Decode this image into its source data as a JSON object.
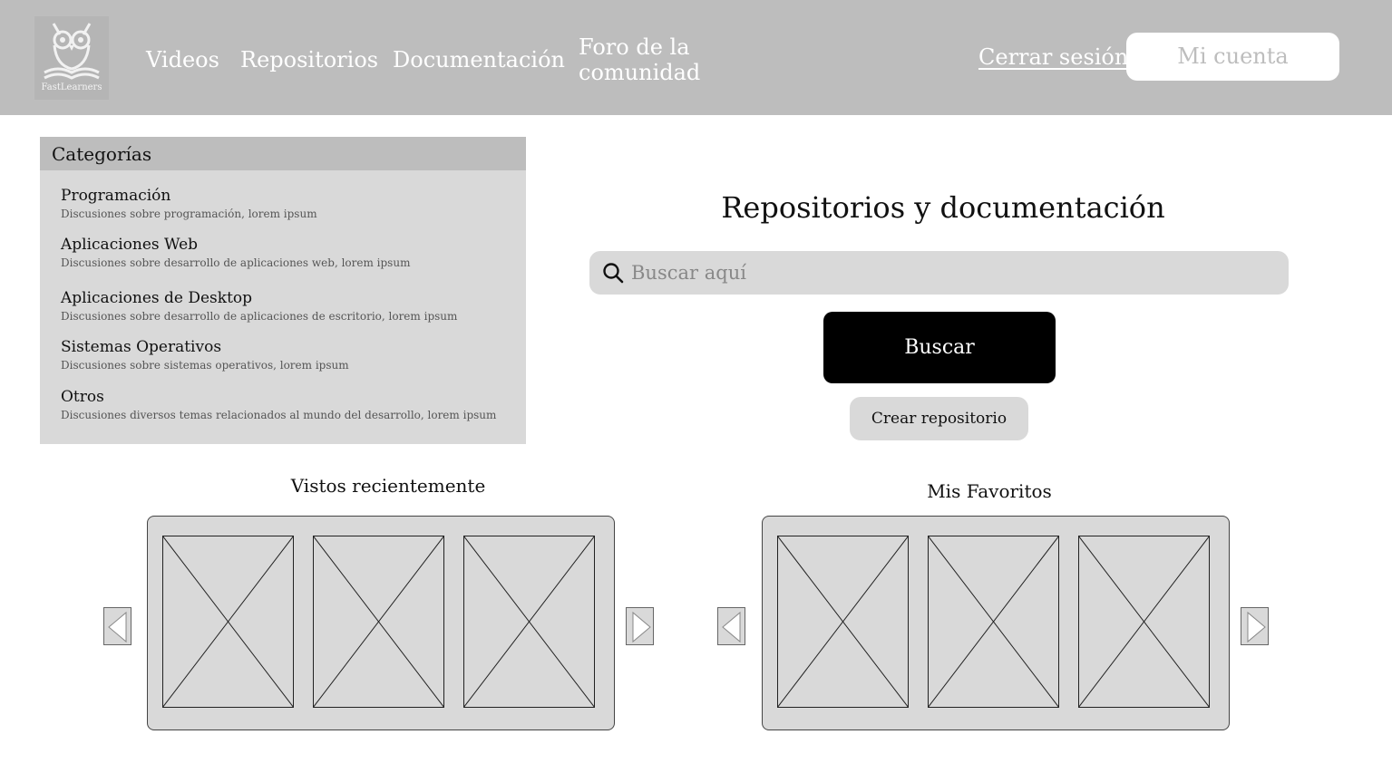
{
  "header": {
    "logo_text": "FastLearners",
    "nav": [
      {
        "label": "Videos"
      },
      {
        "label": "Repositorios"
      },
      {
        "label": "Documentación"
      },
      {
        "label": "Foro de la comunidad"
      }
    ],
    "logout_label": "Cerrar sesión",
    "account_label": "Mi cuenta"
  },
  "categories": {
    "title": "Categorías",
    "items": [
      {
        "name": "Programación",
        "desc": "Discusiones sobre programación, lorem ipsum"
      },
      {
        "name": "Aplicaciones Web",
        "desc": "Discusiones sobre desarrollo de aplicaciones web, lorem ipsum"
      },
      {
        "name": "Aplicaciones de Desktop",
        "desc": "Discusiones sobre desarrollo de aplicaciones de escritorio, lorem ipsum"
      },
      {
        "name": "Sistemas Operativos",
        "desc": "Discusiones sobre sistemas operativos, lorem ipsum"
      },
      {
        "name": "Otros",
        "desc": "Discusiones diversos temas relacionados al mundo del desarrollo, lorem ipsum"
      }
    ]
  },
  "main": {
    "title": "Repositorios y documentación",
    "search_placeholder": "Buscar aquí",
    "search_button": "Buscar",
    "create_button": "Crear repositorio"
  },
  "recent": {
    "title": "Vistos recientemente"
  },
  "favorites": {
    "title": "Mis Favoritos"
  },
  "colors": {
    "header_bg": "#bdbdbd",
    "panel_bg": "#d9d9d9",
    "primary_button": "#000000"
  },
  "icons": [
    "owl-logo-icon",
    "search-icon",
    "arrow-left-icon",
    "arrow-right-icon",
    "image-placeholder-icon"
  ]
}
